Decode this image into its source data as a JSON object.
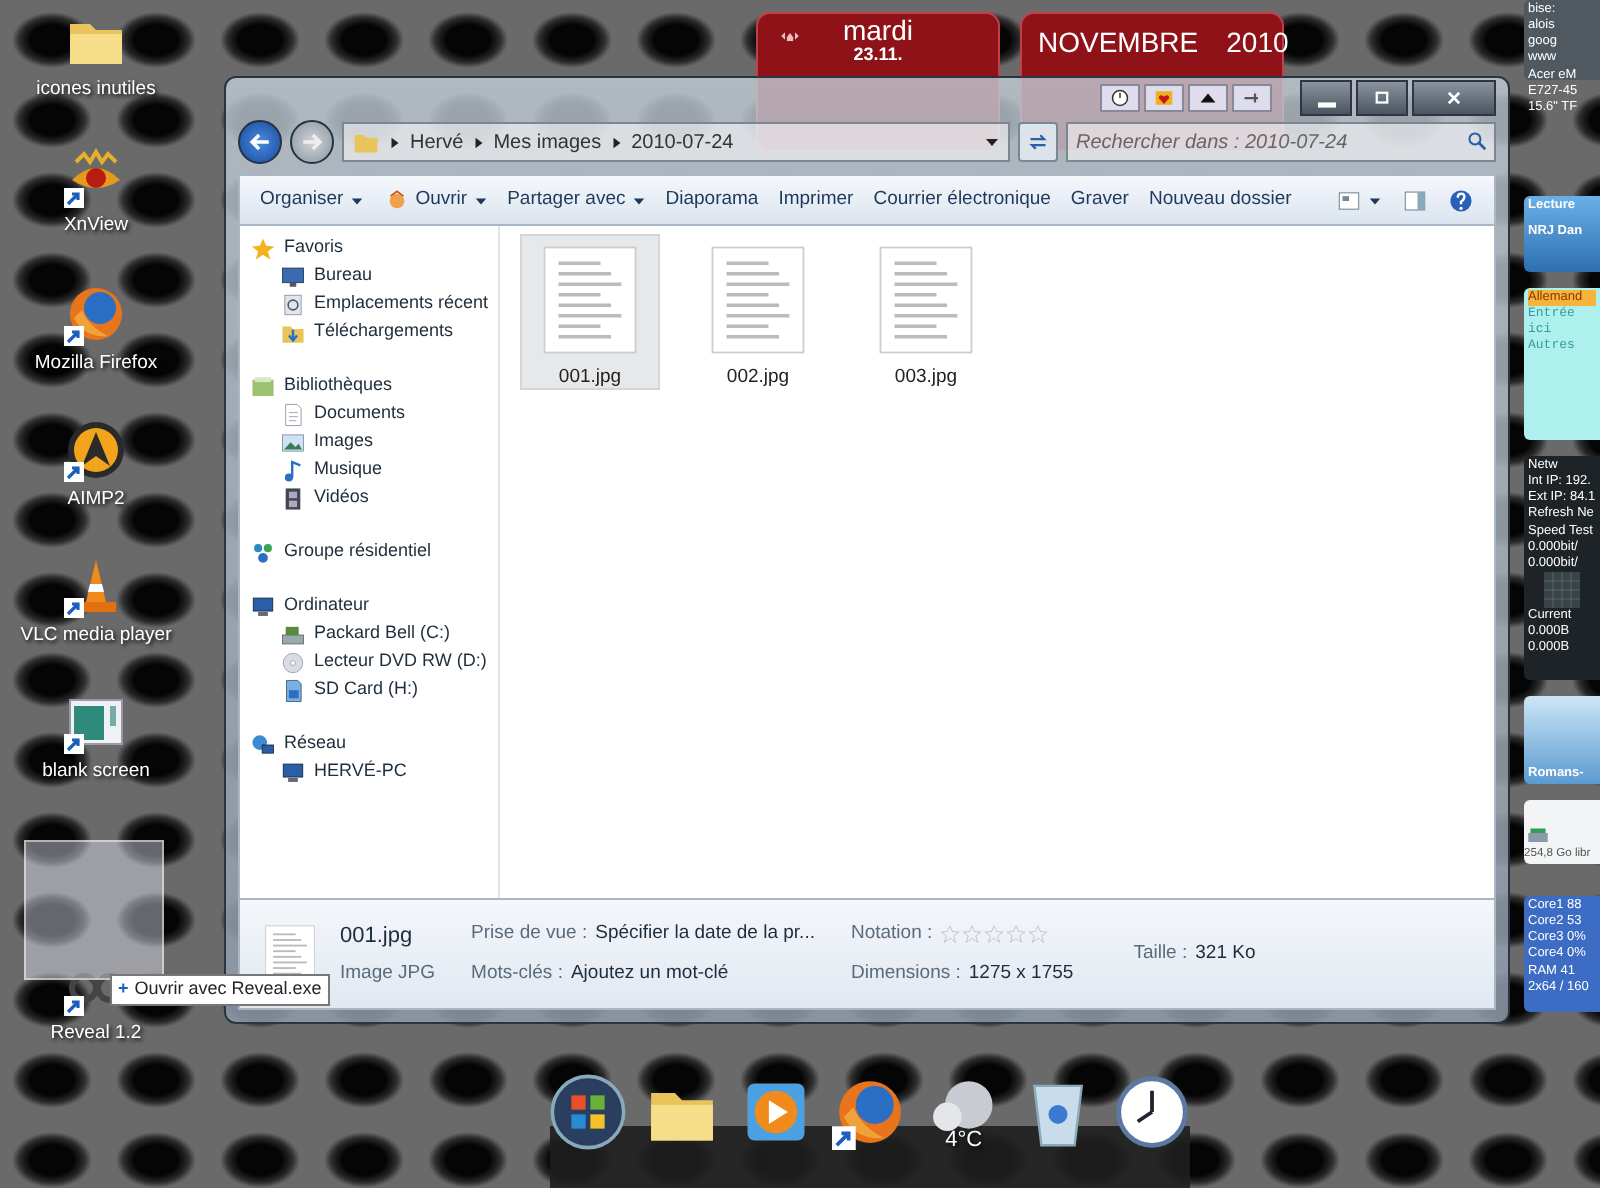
{
  "desktop_icons": [
    {
      "label": "icones inutiles",
      "kind": "folder"
    },
    {
      "label": "XnView",
      "kind": "xnview"
    },
    {
      "label": "Mozilla Firefox",
      "kind": "firefox"
    },
    {
      "label": "AIMP2",
      "kind": "aimp"
    },
    {
      "label": "VLC media player",
      "kind": "vlc"
    },
    {
      "label": "blank screen",
      "kind": "screen"
    },
    {
      "label": "Reveal 1.2",
      "kind": "reveal"
    }
  ],
  "drag": {
    "symbol": "+",
    "text": "Ouvrir avec Reveal.exe"
  },
  "day_widget": {
    "day": "mardi",
    "date": "23.11."
  },
  "month_widget": {
    "month": "NOVEMBRE",
    "year": "2010"
  },
  "explorer": {
    "breadcrumb": [
      "Hervé",
      "Mes images",
      "2010-07-24"
    ],
    "search": {
      "placeholder": "Rechercher dans : 2010-07-24"
    },
    "toolbar": [
      {
        "label": "Organiser",
        "dropdown": true
      },
      {
        "label": "Ouvrir",
        "dropdown": true,
        "kind": "open"
      },
      {
        "label": "Partager avec",
        "dropdown": true
      },
      {
        "label": "Diaporama",
        "dropdown": false
      },
      {
        "label": "Imprimer",
        "dropdown": false
      },
      {
        "label": "Courrier électronique",
        "dropdown": false
      },
      {
        "label": "Graver",
        "dropdown": false
      },
      {
        "label": "Nouveau dossier",
        "dropdown": false
      }
    ],
    "nav": [
      {
        "label": "Favoris",
        "kind": "star",
        "children": [
          {
            "label": "Bureau",
            "kind": "desktop"
          },
          {
            "label": "Emplacements récent",
            "kind": "recent"
          },
          {
            "label": "Téléchargements",
            "kind": "download"
          }
        ]
      },
      {
        "label": "Bibliothèques",
        "kind": "library",
        "children": [
          {
            "label": "Documents",
            "kind": "document"
          },
          {
            "label": "Images",
            "kind": "images"
          },
          {
            "label": "Musique",
            "kind": "music"
          },
          {
            "label": "Vidéos",
            "kind": "video"
          }
        ]
      },
      {
        "label": "Groupe résidentiel",
        "kind": "homegroup"
      },
      {
        "label": "Ordinateur",
        "kind": "computer",
        "children": [
          {
            "label": "Packard Bell (C:)",
            "kind": "drive"
          },
          {
            "label": "Lecteur DVD RW (D:)",
            "kind": "dvd"
          },
          {
            "label": "SD Card (H:)",
            "kind": "sd"
          }
        ]
      },
      {
        "label": "Réseau",
        "kind": "network",
        "children": [
          {
            "label": "HERVÉ-PC",
            "kind": "computer"
          }
        ]
      }
    ],
    "files": [
      {
        "name": "001.jpg",
        "selected": true
      },
      {
        "name": "002.jpg",
        "selected": false
      },
      {
        "name": "003.jpg",
        "selected": false
      }
    ],
    "details": {
      "filename": "001.jpg",
      "type": "Image JPG",
      "fields": [
        {
          "label": "Prise de vue :",
          "value": "Spécifier la date de la pr..."
        },
        {
          "label": "Mots-clés :",
          "value": "Ajoutez un mot-clé"
        },
        {
          "label": "Notation :",
          "stars": 0
        },
        {
          "label": "Dimensions :",
          "value": "1275 x 1755"
        },
        {
          "label": "Taille :",
          "value": "321 Ko"
        }
      ]
    }
  },
  "gadgets": [
    {
      "kind": "links",
      "lines": [
        "bise:",
        "alois",
        "goog",
        "www",
        "Acer eM",
        "E727-45",
        "15.6\" TF"
      ]
    },
    {
      "kind": "radio",
      "lines": [
        "Lecture",
        "NRJ Dan"
      ]
    },
    {
      "kind": "dictionary",
      "lines": [
        "Allemand",
        "Entrée",
        "ici",
        "Autres"
      ]
    },
    {
      "kind": "network",
      "lines": [
        "Netw",
        "Int IP: 192.",
        "Ext IP: 84.1",
        "Refresh Ne",
        "Speed Test",
        "0.000bit/",
        "0.000bit/",
        "Current",
        "0.000B",
        "0.000B"
      ]
    },
    {
      "kind": "books",
      "lines": [
        "Romans-"
      ]
    },
    {
      "kind": "drive",
      "lines": [
        "254,8 Go libr"
      ]
    },
    {
      "kind": "cpu",
      "lines": [
        "Core1 88",
        "Core2 53",
        "Core3 0%",
        "Core4 0%",
        "RAM 41",
        "2x64 / 160"
      ]
    }
  ],
  "dock": [
    {
      "kind": "start"
    },
    {
      "kind": "folder"
    },
    {
      "kind": "media"
    },
    {
      "kind": "firefox"
    },
    {
      "kind": "weather",
      "label": "4°C"
    },
    {
      "kind": "trash"
    },
    {
      "kind": "clock"
    }
  ]
}
